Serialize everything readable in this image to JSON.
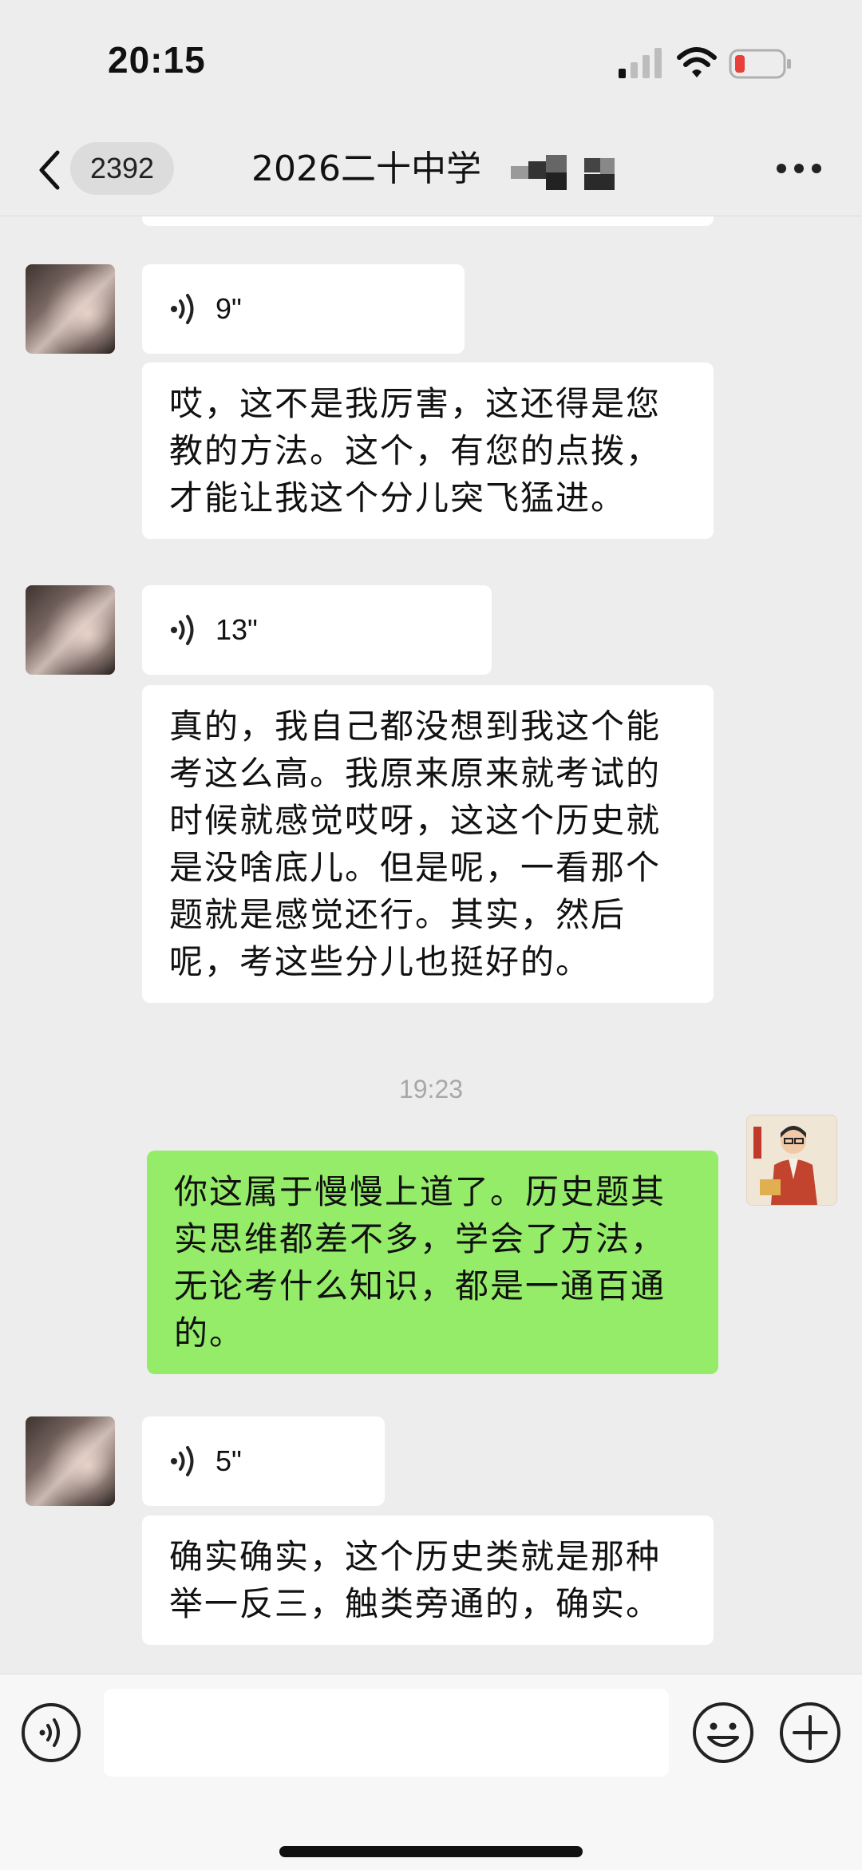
{
  "status_bar": {
    "time": "20:15"
  },
  "nav": {
    "unread_count": "2392",
    "title": "2026二十中学"
  },
  "messages": [
    {
      "sender": "contact",
      "type": "voice",
      "duration": "9\""
    },
    {
      "sender": "contact",
      "type": "text",
      "lines": [
        "哎，这不是我厉害，这还得是您",
        "教的方法。这个，有您的点拨，",
        "才能让我这个分儿突飞猛进。"
      ]
    },
    {
      "sender": "contact",
      "type": "voice",
      "duration": "13\""
    },
    {
      "sender": "contact",
      "type": "text",
      "lines": [
        "真的，我自己都没想到我这个能",
        "考这么高。我原来原来就考试的",
        "时候就感觉哎呀，这这个历史就",
        "是没啥底儿。但是呢，一看那个",
        "题就是感觉还行。其实，然后",
        "呢，考这些分儿也挺好的。"
      ]
    },
    {
      "type": "timestamp",
      "text": "19:23"
    },
    {
      "sender": "me",
      "type": "text",
      "lines": [
        "你这属于慢慢上道了。历史题其",
        "实思维都差不多，学会了方法，",
        "无论考什么知识，都是一通百通",
        "的。"
      ]
    },
    {
      "sender": "contact",
      "type": "voice",
      "duration": "5\""
    },
    {
      "sender": "contact",
      "type": "text",
      "lines": [
        "确实确实，这个历史类就是那种",
        "举一反三，触类旁通的，确实。"
      ]
    }
  ],
  "input": {
    "value": ""
  },
  "icons": {
    "back": "chevron-left-icon",
    "more": "more-icon",
    "voice": "voice-icon",
    "emoji": "emoji-icon",
    "plus": "plus-icon"
  },
  "colors": {
    "background": "#ededed",
    "my_bubble": "#95ec69",
    "their_bubble": "#ffffff"
  }
}
